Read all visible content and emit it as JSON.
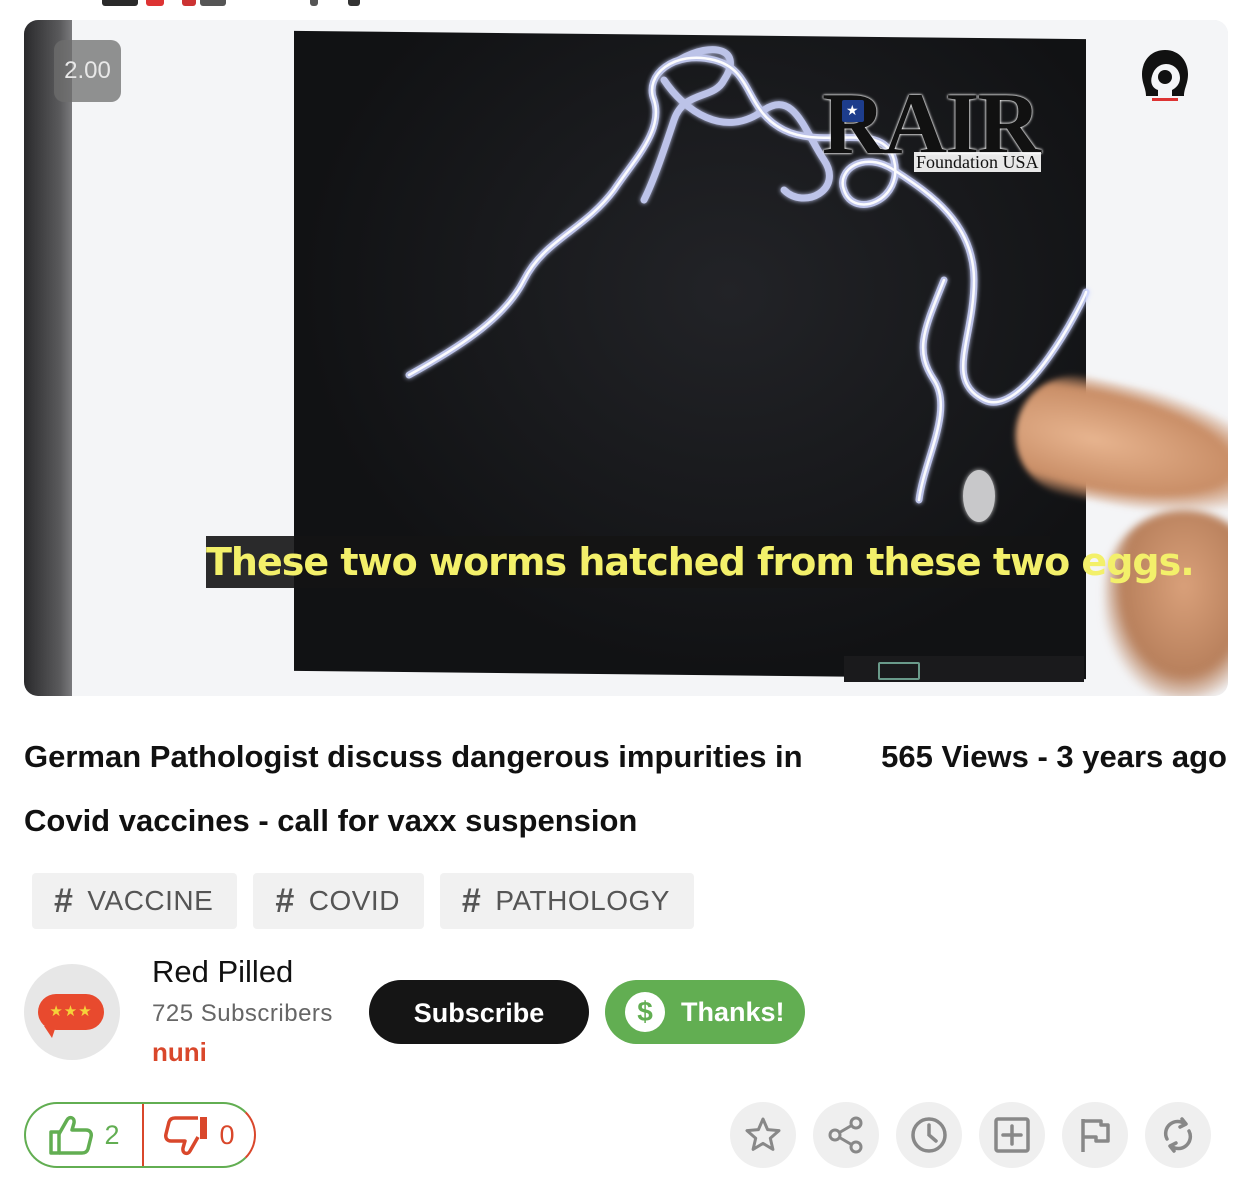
{
  "player": {
    "playback_speed": "2.00",
    "subtitle": "These two worms hatched from these two eggs.",
    "watermark_logo": {
      "main": "RAIR",
      "sub": "Foundation USA"
    }
  },
  "video": {
    "title": "German Pathologist discuss dangerous impurities in Covid vaccines - call for vaxx suspension",
    "meta": "565 Views - 3 years ago"
  },
  "tags": [
    {
      "label": "VACCINE"
    },
    {
      "label": "COVID"
    },
    {
      "label": "PATHOLOGY"
    }
  ],
  "channel": {
    "name": "Red Pilled",
    "subscribers": "725 Subscribers",
    "rank": "nuni",
    "avatar_stars": "★★★"
  },
  "buttons": {
    "subscribe": "Subscribe",
    "thanks": "Thanks!",
    "thanks_icon": "$"
  },
  "votes": {
    "likes": "2",
    "dislikes": "0"
  },
  "actions": [
    {
      "icon": "star-icon"
    },
    {
      "icon": "share-icon"
    },
    {
      "icon": "clock-icon"
    },
    {
      "icon": "add-to-playlist-icon"
    },
    {
      "icon": "flag-icon"
    },
    {
      "icon": "loop-icon"
    }
  ],
  "colors": {
    "accent_green": "#62ae52",
    "accent_red": "#d9472b",
    "subtitle_yellow": "#f3f06a"
  }
}
